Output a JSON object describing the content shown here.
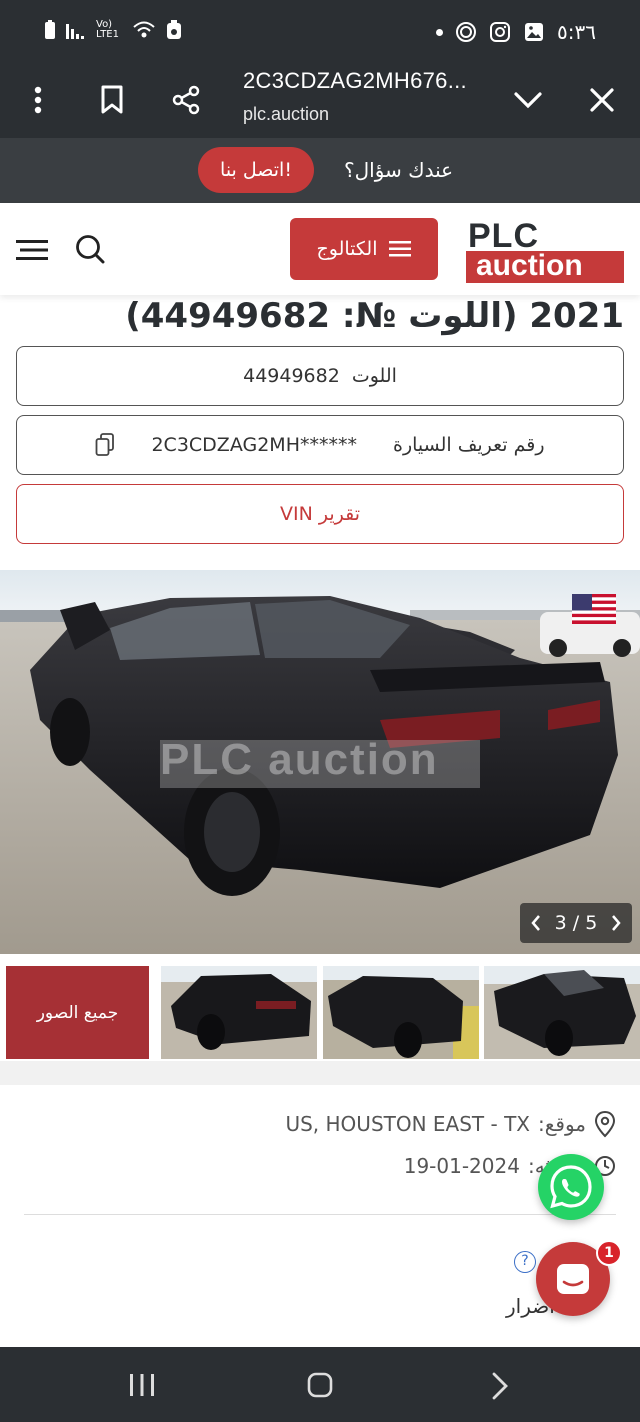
{
  "status_bar": {
    "time": "٥:٣٦",
    "network_label": "Vo) LTE1",
    "icons": [
      "battery-icon",
      "signal-icon",
      "wifi-icon",
      "recycle-icon",
      "dot-icon",
      "spiral-app-icon",
      "instagram-icon",
      "gallery-icon"
    ]
  },
  "browser": {
    "title": "2C3CDZAG2MH676...",
    "url": "plc.auction",
    "icons": [
      "more-vert-icon",
      "bookmark-icon",
      "share-icon",
      "chevron-down-icon",
      "close-icon"
    ]
  },
  "ask_bar": {
    "question": "عندك سؤال؟",
    "contact_label": "اتصل بنا!"
  },
  "header": {
    "catalog_label": "الكتالوج",
    "logo_top": "PLC",
    "logo_bottom": "auction"
  },
  "lot": {
    "title": "2021 (اللوت №: 44949682)",
    "lot_label": "اللوت",
    "lot_number": "44949682",
    "vin_label": "رقم تعريف السيارة",
    "vin_value": "2C3CDZAG2MH******",
    "vin_report": "تقرير VIN"
  },
  "gallery": {
    "counter": "3 / 5",
    "watermark": "PLC auction",
    "all_photos": "جميع الصور"
  },
  "details": {
    "location_label": "موقع:",
    "location_value": "US, HOUSTON EAST - TX",
    "updated_label": "تحديثه:",
    "updated_value": "19-01-2024",
    "damage_label": "أضرار"
  },
  "chat": {
    "badge": "1"
  },
  "colors": {
    "brand_red": "#c53a3a",
    "dark_bar": "#2b2f33",
    "whatsapp": "#25d366"
  }
}
